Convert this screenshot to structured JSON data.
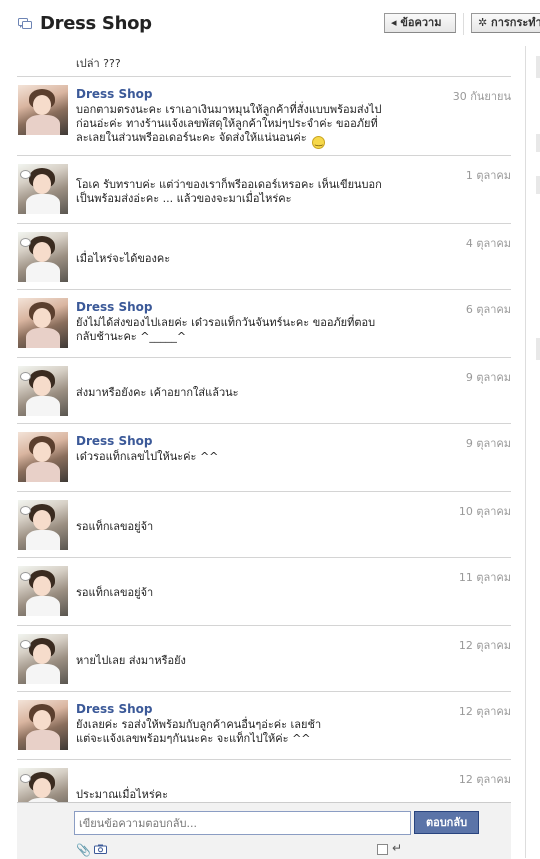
{
  "header": {
    "title": "Dress Shop",
    "messages_button": "◂ ข้อความ",
    "actions_button": "✲ การกระทำ"
  },
  "first_message_tail": "เปล่า ???",
  "messages": [
    {
      "sender": "Dress Shop",
      "date": "30 กันยายน",
      "avatar": "shop",
      "lines": [
        "บอกตามตรงนะคะ เราเอาเงินมาหมุนให้ลูกค้าที่สั่งแบบพร้อมส่งไป",
        "ก่อนอ่ะค่ะ ทางร้านแจ้งเลขพัสดุให้ลูกค้าใหม่ๆประจำค่ะ ขออภัยที่",
        "ละเลยในส่วนพรีออเดอร์นะคะ จัดส่งให้แน่นอนค่ะ"
      ],
      "emoticon": "smiley"
    },
    {
      "sender": "",
      "date": "1 ตุลาคม",
      "avatar": "customer",
      "lines": [
        "โอเค รับทราบค่ะ แต่ว่าของเราก็พรีออเดอร์เหรอคะ เห็นเขียนบอก",
        "เป็นพร้อมส่งอ่ะคะ ... แล้วของจะมาเมื่อไหร่คะ"
      ]
    },
    {
      "sender": "",
      "date": "4 ตุลาคม",
      "avatar": "customer",
      "lines": [
        "เมื่อไหร่จะได้ของคะ"
      ]
    },
    {
      "sender": "Dress Shop",
      "date": "6 ตุลาคม",
      "avatar": "shop",
      "lines": [
        "ยังไม่ได้ส่งของไปเลยค่ะ เด๋วรอแท็กวันจันทร์นะคะ ขออภัยที่ตอบ",
        "กลับช้านะคะ ^_____^"
      ]
    },
    {
      "sender": "",
      "date": "9 ตุลาคม",
      "avatar": "customer",
      "lines": [
        "ส่งมาหรือยังคะ เค้าอยากใส่แล้วนะ"
      ]
    },
    {
      "sender": "Dress Shop",
      "date": "9 ตุลาคม",
      "avatar": "shop",
      "lines": [
        "เด๋วรอแท็กเลขไปให้นะค่ะ ^^"
      ]
    },
    {
      "sender": "",
      "date": "10 ตุลาคม",
      "avatar": "customer",
      "lines": [
        "รอแท็กเลขอยู่จ้า"
      ]
    },
    {
      "sender": "",
      "date": "11 ตุลาคม",
      "avatar": "customer",
      "lines": [
        "รอแท็กเลขอยู่จ้า"
      ]
    },
    {
      "sender": "",
      "date": "12 ตุลาคม",
      "avatar": "customer",
      "lines": [
        "หายไปเลย ส่งมาหรือยัง"
      ]
    },
    {
      "sender": "Dress Shop",
      "date": "12 ตุลาคม",
      "avatar": "shop",
      "lines": [
        "ยังเลยค่ะ รอส่งให้พร้อมกับลูกค้าคนอื่นๆอ่ะค่ะ เลยช้า",
        "แต่จะแจ้งเลขพร้อมๆกันนะคะ จะแท็กไปให้ค่ะ ^^"
      ]
    },
    {
      "sender": "",
      "date": "12 ตุลาคม",
      "avatar": "customer",
      "lines": [
        "ประมาณเมื่อไหร่คะ"
      ]
    }
  ],
  "composer": {
    "placeholder": "เขียนข้อความตอบกลับ...",
    "reply_button": "ตอบกลับ",
    "attach_icon": "paperclip-icon",
    "camera_icon": "camera-icon",
    "enter_icon": "enter-icon"
  },
  "colors": {
    "link": "#3b5998",
    "button": "#5b74a8"
  }
}
